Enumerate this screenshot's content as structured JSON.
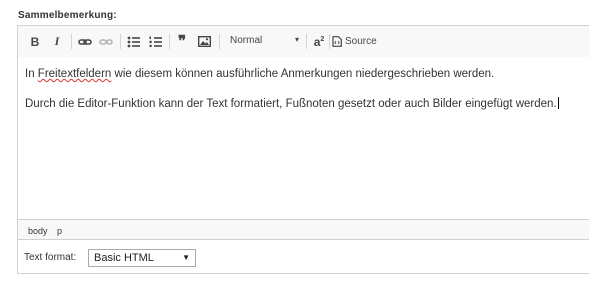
{
  "field": {
    "label": "Sammelbemerkung:"
  },
  "toolbar": {
    "bold_label": "B",
    "italic_label": "I",
    "icons": [
      "bold",
      "italic",
      "link",
      "unlink",
      "bulleted-list",
      "numbered-list",
      "blockquote",
      "image",
      "format",
      "superscript",
      "source"
    ],
    "blockquote_label": "❞",
    "format_value": "Normal",
    "superscript_label": "a",
    "superscript_sup": "2",
    "source_label": "Source"
  },
  "content": {
    "p1_before": "In ",
    "p1_misspelled": "Freitextfeldern",
    "p1_after": " wie diesem können ausführliche Anmerkungen niedergeschrieben werden.",
    "p2": "Durch die Editor-Funktion kann der Text formatiert, Fußnoten gesetzt oder auch Bilder eingefügt werden."
  },
  "path": {
    "items": [
      "body",
      "p"
    ]
  },
  "text_format": {
    "label": "Text format:",
    "selected": "Basic HTML"
  }
}
